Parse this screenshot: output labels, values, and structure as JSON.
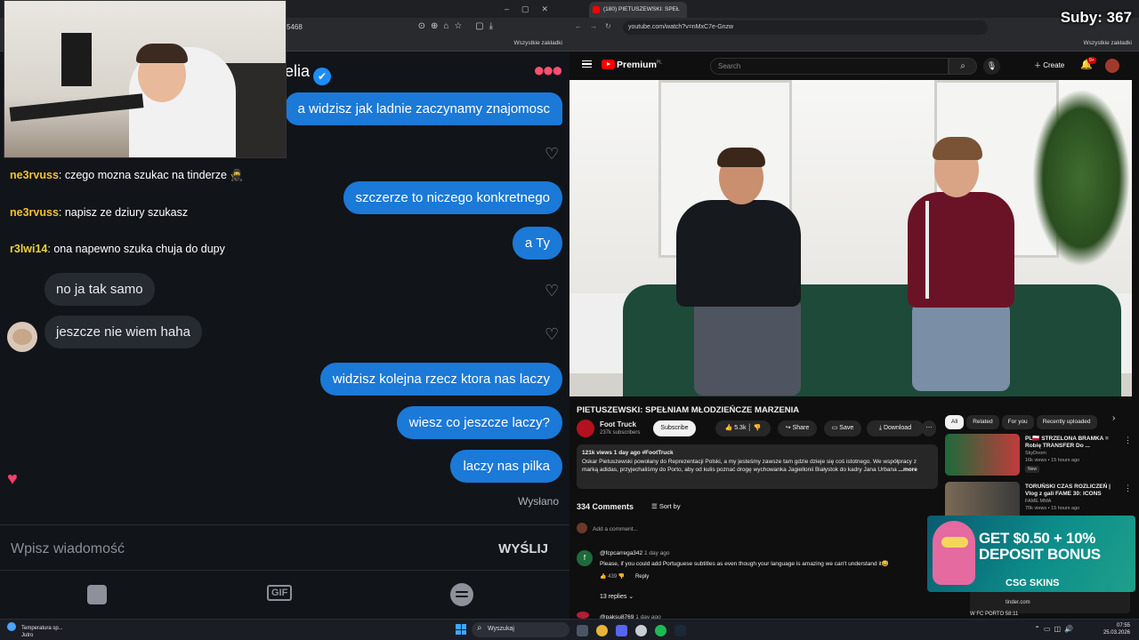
{
  "left_browser": {
    "address_fragment": "5468",
    "bookmarks_label": "Wszystkie zakładki"
  },
  "chat": {
    "header_name": "elia",
    "verified_icon": "check-icon",
    "messages_out": [
      "a widzisz jak ladnie zaczynamy znajomosc",
      "szczerze to niczego konkretnego",
      "a Ty",
      "widzisz kolejna rzecz ktora nas laczy",
      "wiesz co jeszcze laczy?",
      "laczy nas pilka"
    ],
    "messages_in": [
      "no ja tak samo",
      "jeszcze nie wiem haha"
    ],
    "status": "Wysłano",
    "accent_color": "#1b79d8"
  },
  "twitch_chat": [
    {
      "user": "ne3rvuss",
      "text": "czego mozna szukac na tinderze 🥷"
    },
    {
      "user": "ne3rvuss",
      "text": "napisz ze dziury szukasz"
    },
    {
      "user": "r3lwi14",
      "text": "ona napewno szuka chuja do dupy"
    }
  ],
  "compose": {
    "placeholder": "Wpisz wiadomość",
    "send_label": "WYŚLIJ"
  },
  "bottom_bar": {
    "gif_label": "GIF"
  },
  "right_browser": {
    "tab_title": "(180) PIETUSZEWSKI: SPEŁ",
    "url": "youtube.com/watch?v=nMxC7e-Gnzw",
    "bookmarks_label": "Wszystkie zakładki"
  },
  "youtube": {
    "logo": "Premium",
    "logo_sup": "PL",
    "search_placeholder": "Search",
    "create_label": "Create",
    "notif_badge": "9+",
    "video_title": "PIETUSZEWSKI: SPEŁNIAM MŁODZIEŃCZE MARZENIA",
    "channel": "Foot Truck",
    "subscribers": "237k subscribers",
    "subscribe_label": "Subscribe",
    "likes": "5.3k",
    "share_label": "Share",
    "save_label": "Save",
    "download_label": "Download",
    "desc_meta": "121k views  1 day ago  #FootTruck",
    "desc_text": "Oskar Pietuszewski powołany do Reprezentacji Polski, a my jesteśmy zawsze tam gdzie dzieje się coś istotnego. We współpracy z marką adidas, przyjechaliśmy do Porto, aby od kulis poznać drogę wychowanka Jagiellonii Białystok do kadry Jana Urbana",
    "desc_more": "...more",
    "comments_count": "334 Comments",
    "sort_label": "Sort by",
    "add_comment": "Add a comment...",
    "comment": {
      "user": "@fcpcarrega342",
      "time": "1 day ago",
      "text": "Please, if you could add Portuguese subtitles as even though your language is amazing we can't understand it😅",
      "likes": "439",
      "reply_label": "Reply",
      "replies": "13 replies"
    },
    "comment2_user": "@paksu8769",
    "comment2_time": "1 day ago",
    "chips": [
      "All",
      "Related",
      "For you",
      "Recently uploaded"
    ],
    "related": [
      {
        "title": "PL🇵🇱 STRZELONA BRAMKA = Robię TRANSFER Do ...",
        "channel": "SkyDoom",
        "meta": "16k views • 15 hours ago",
        "badge": "New"
      },
      {
        "title": "TORUŃSKI CZAS ROZLICZEŃ | Vlog z gali FAME 30: ICONS",
        "channel": "FAME MMA",
        "meta": "70k views • 15 hours ago",
        "badge": ""
      }
    ]
  },
  "overlay": {
    "subs_counter": "Suby: 367",
    "ad_line1": "GET $0.50 + 10%",
    "ad_line2": "DEPOSIT BONUS",
    "ad_brand": "CSG SKINS",
    "tinder_url": "tinder.com",
    "related_footer": "W FC PORTO 58:11"
  },
  "taskbar": {
    "weather_title": "Temperatura sp...",
    "weather_sub": "Jutro",
    "search_label": "Wyszukaj",
    "time": "07:55",
    "date": "25.03.2026"
  }
}
